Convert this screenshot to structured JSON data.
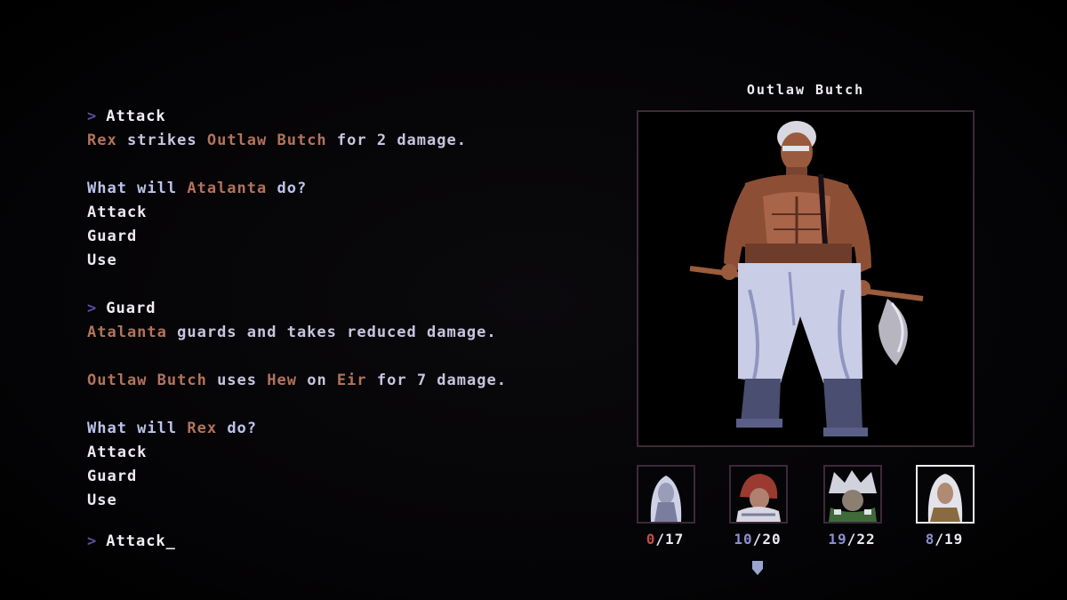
{
  "log": {
    "prompt_symbol": ">",
    "block1": {
      "command": "Attack",
      "actor": "Rex",
      "verb": " strikes ",
      "target": "Outlaw Butch",
      "rest": " for 2 damage."
    },
    "block2": {
      "q_pre": "What will ",
      "q_name": "Atalanta",
      "q_post": " do?",
      "options": [
        "Attack",
        "Guard",
        "Use"
      ]
    },
    "block3": {
      "command": "Guard",
      "actor": "Atalanta",
      "rest": " guards and takes reduced damage."
    },
    "block4": {
      "actor": "Outlaw Butch",
      "mid1": " uses ",
      "skill": "Hew",
      "mid2": " on ",
      "target": "Eir",
      "rest": " for 7 damage."
    },
    "block5": {
      "q_pre": "What will ",
      "q_name": "Rex",
      "q_post": " do?",
      "options": [
        "Attack",
        "Guard",
        "Use"
      ]
    },
    "input": {
      "text": "Attack",
      "cursor": "_"
    }
  },
  "enemy": {
    "name": "Outlaw Butch"
  },
  "party": [
    {
      "portrait": "white-haired-elf-portrait",
      "hp_current": "0",
      "hp_sep": "/",
      "hp_max": "17",
      "active": false
    },
    {
      "portrait": "red-hooded-portrait",
      "hp_current": "10",
      "hp_sep": "/",
      "hp_max": "20",
      "active": false
    },
    {
      "portrait": "wild-haired-portrait",
      "hp_current": "19",
      "hp_sep": "/",
      "hp_max": "22",
      "active": false
    },
    {
      "portrait": "white-haired-woman-portrait",
      "hp_current": "8",
      "hp_sep": "/",
      "hp_max": "19",
      "active": true
    }
  ],
  "colors": {
    "name_highlight": "#b3735c",
    "prompt_arrow": "#5a4fa0",
    "frame_border": "#3c2a3a",
    "active_border": "#f2eef4",
    "hp_zero": "#c24a44",
    "hp_current": "#8a8fd0"
  }
}
